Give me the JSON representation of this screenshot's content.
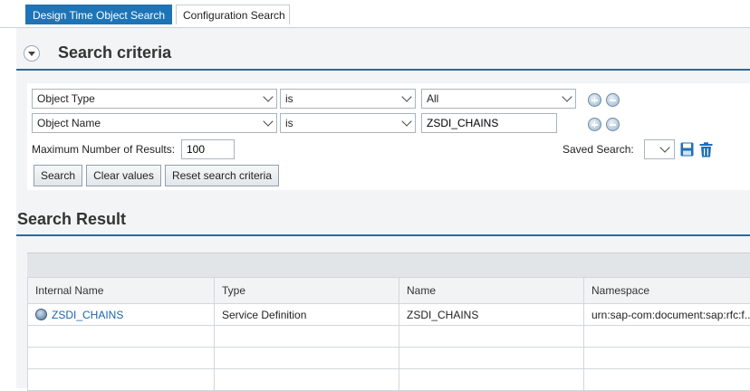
{
  "tabs": [
    {
      "label": "Design Time Object Search",
      "active": true
    },
    {
      "label": "Configuration Search",
      "active": false
    }
  ],
  "criteria": {
    "title": "Search criteria",
    "rows": [
      {
        "attribute": "Object Type",
        "operator": "is",
        "value": "All",
        "value_type": "dropdown"
      },
      {
        "attribute": "Object Name",
        "operator": "is",
        "value": "ZSDI_CHAINS",
        "value_type": "text"
      }
    ],
    "max_results_label": "Maximum Number of Results:",
    "max_results_value": "100",
    "saved_search_label": "Saved Search:",
    "saved_search_value": "",
    "buttons": {
      "search": "Search",
      "clear": "Clear values",
      "reset": "Reset search criteria"
    }
  },
  "results": {
    "title": "Search Result",
    "columns": [
      "Internal Name",
      "Type",
      "Name",
      "Namespace"
    ],
    "rows": [
      [
        "ZSDI_CHAINS",
        "Service Definition",
        "ZSDI_CHAINS",
        "urn:sap-com:document:sap:rfc:f..."
      ]
    ]
  },
  "colors": {
    "accent": "#1d74b6",
    "section_rule": "#1e6db0",
    "link": "#1c62ad"
  },
  "icons": [
    "collapse-icon",
    "add-row-icon",
    "remove-row-icon",
    "save-icon",
    "delete-icon",
    "service-definition-icon"
  ]
}
